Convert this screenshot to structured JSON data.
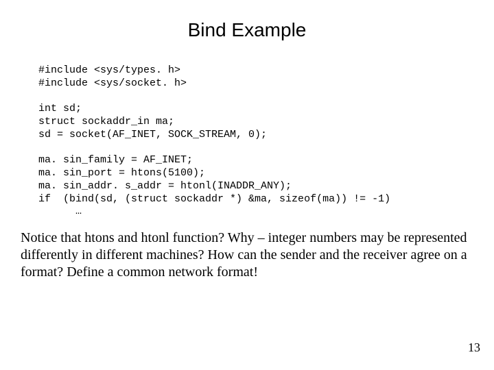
{
  "title": "Bind Example",
  "code": "#include <sys/types. h>\n#include <sys/socket. h>\n\nint sd;\nstruct sockaddr_in ma;\nsd = socket(AF_INET, SOCK_STREAM, 0);\n\nma. sin_family = AF_INET;\nma. sin_port = htons(5100);\nma. sin_addr. s_addr = htonl(INADDR_ANY);\nif  (bind(sd, (struct sockaddr *) &ma, sizeof(ma)) != -1)\n      …",
  "paragraph": "Notice that htons and htonl function? Why – integer numbers may be represented differently in different machines? How can the sender and the receiver agree on a format? Define a common network format!",
  "page_number": "13"
}
